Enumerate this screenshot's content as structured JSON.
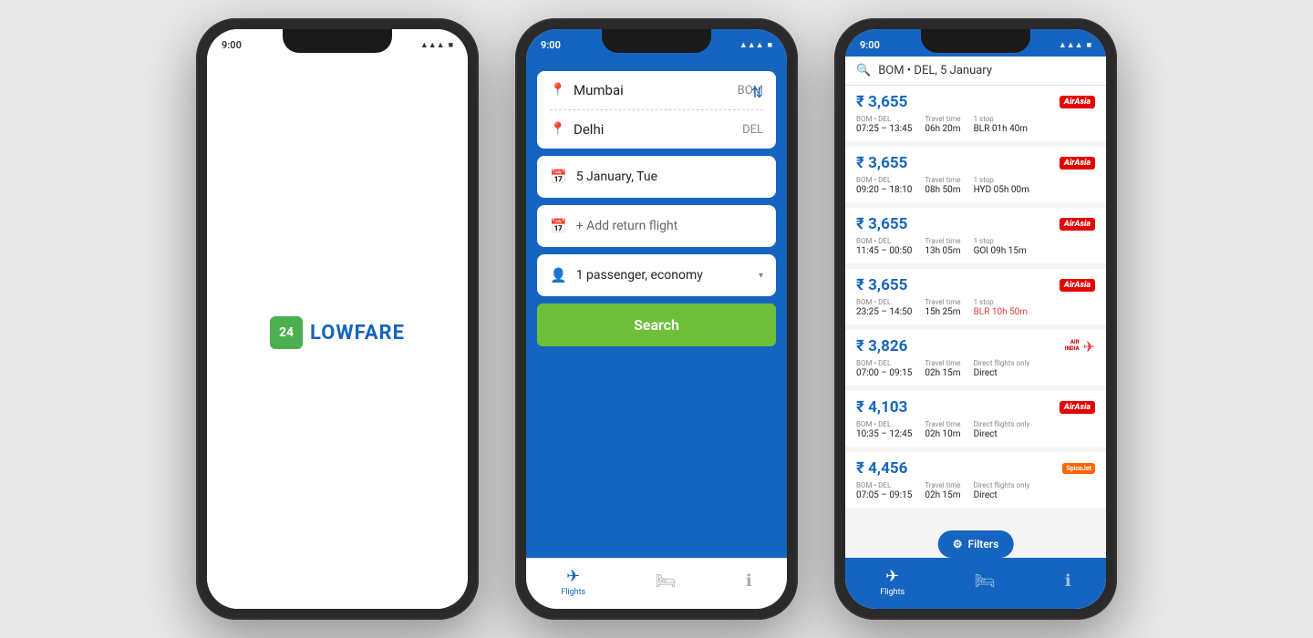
{
  "phone1": {
    "status": {
      "time": "9:00",
      "battery": "▓▓▓",
      "signal": "▲▲▲"
    },
    "logo": {
      "icon": "24",
      "text": "LOWFARE"
    }
  },
  "phone2": {
    "status": {
      "time": "9:00",
      "battery": "▓▓▓",
      "signal": "▲▲▲"
    },
    "origin": {
      "city": "Mumbai",
      "code": "BOM"
    },
    "destination": {
      "city": "Delhi",
      "code": "DEL"
    },
    "date": "5 January, Tue",
    "return": "+ Add return flight",
    "passengers": "1 passenger, economy",
    "search_btn": "Search",
    "nav": [
      {
        "label": "Flights",
        "active": true
      },
      {
        "label": "",
        "active": false
      },
      {
        "label": "",
        "active": false
      }
    ]
  },
  "phone3": {
    "status": {
      "time": "9:00",
      "battery": "▓▓▓",
      "signal": "▲▲▲"
    },
    "search_text": "BOM • DEL, 5 January",
    "flights": [
      {
        "price": "₹ 3,655",
        "airline": "airasia",
        "route": "BOM • DEL",
        "departure": "07:25 – 13:45",
        "travel_time_label": "Travel time",
        "travel_time": "06h 20m",
        "stop_label": "1 stop",
        "stop_via": "BLR 01h 40m",
        "stop_red": false
      },
      {
        "price": "₹ 3,655",
        "airline": "airasia",
        "route": "BOM • DEL",
        "departure": "09:20 – 18:10",
        "travel_time_label": "Travel time",
        "travel_time": "08h 50m",
        "stop_label": "1 stop",
        "stop_via": "HYD 05h 00m",
        "stop_red": false
      },
      {
        "price": "₹ 3,655",
        "airline": "airasia",
        "route": "BOM • DEL",
        "departure": "11:45 – 00:50",
        "travel_time_label": "Travel time",
        "travel_time": "13h 05m",
        "stop_label": "1 stop",
        "stop_via": "GOI 09h 15m",
        "stop_red": false
      },
      {
        "price": "₹ 3,655",
        "airline": "airasia",
        "route": "BOM • DEL",
        "departure": "23:25 – 14:50",
        "travel_time_label": "Travel time",
        "travel_time": "15h 25m",
        "stop_label": "1 stop",
        "stop_via": "BLR 10h 50m",
        "stop_red": true
      },
      {
        "price": "₹ 3,826",
        "airline": "airindia",
        "route": "BOM • DEL",
        "departure": "07:00 – 09:15",
        "travel_time_label": "Travel time",
        "travel_time": "02h 15m",
        "stop_label": "Direct flights only",
        "stop_via": "Direct",
        "stop_red": false
      },
      {
        "price": "₹ 4,103",
        "airline": "airasia",
        "route": "BOM • DEL",
        "departure": "10:35 – 12:45",
        "travel_time_label": "Travel time",
        "travel_time": "02h 10m",
        "stop_label": "Direct flights only",
        "stop_via": "Direct",
        "stop_red": false
      },
      {
        "price": "₹ 4,456",
        "airline": "spicejet",
        "route": "BOM • DEL",
        "departure": "07:05 – 09:15",
        "travel_time_label": "Travel time",
        "travel_time": "02h 15m",
        "stop_label": "Direct flights only",
        "stop_via": "Direct",
        "stop_red": false
      }
    ],
    "filters_btn": "Filters",
    "nav": [
      {
        "label": "Flights",
        "active": true
      },
      {
        "label": "",
        "active": false
      },
      {
        "label": "",
        "active": false
      }
    ]
  },
  "colors": {
    "blue": "#1565c0",
    "green": "#6dbf3a",
    "airasia_red": "#e60000",
    "spicejet_orange": "#ff6600"
  }
}
